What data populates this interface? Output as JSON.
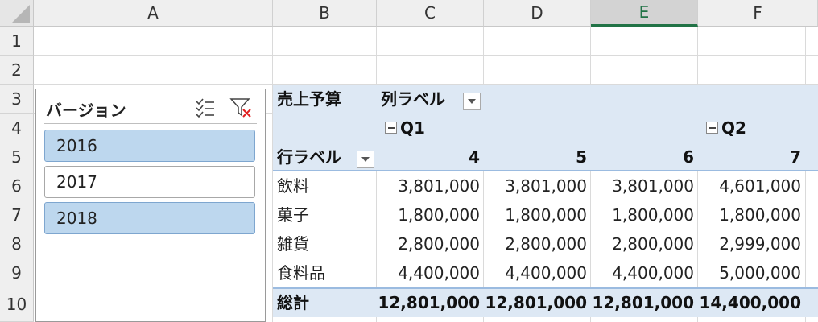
{
  "columns": [
    "A",
    "B",
    "C",
    "D",
    "E",
    "F"
  ],
  "selected_column": "E",
  "rows": [
    "1",
    "2",
    "3",
    "4",
    "5",
    "6",
    "7",
    "8",
    "9",
    "10"
  ],
  "slicer": {
    "title": "バージョン",
    "items": [
      {
        "label": "2016",
        "selected": true
      },
      {
        "label": "2017",
        "selected": false
      },
      {
        "label": "2018",
        "selected": true
      }
    ]
  },
  "pivot": {
    "value_label": "売上予算",
    "column_label": "列ラベル",
    "row_label": "行ラベル",
    "quarters": [
      "Q1",
      "Q2"
    ],
    "months": [
      "4",
      "5",
      "6",
      "7"
    ],
    "rows": [
      {
        "label": "飲料",
        "values": [
          "3,801,000",
          "3,801,000",
          "3,801,000",
          "4,601,000"
        ]
      },
      {
        "label": "菓子",
        "values": [
          "1,800,000",
          "1,800,000",
          "1,800,000",
          "1,800,000"
        ]
      },
      {
        "label": "雑貨",
        "values": [
          "2,800,000",
          "2,800,000",
          "2,800,000",
          "2,999,000"
        ]
      },
      {
        "label": "食料品",
        "values": [
          "4,400,000",
          "4,400,000",
          "4,400,000",
          "5,000,000"
        ]
      }
    ],
    "total": {
      "label": "総計",
      "values": [
        "12,801,000",
        "12,801,000",
        "12,801,000",
        "14,400,000"
      ]
    }
  },
  "colors": {
    "pivot_header": "#dde8f4",
    "slicer_selected": "#bdd7ee",
    "accent": "#217346"
  }
}
